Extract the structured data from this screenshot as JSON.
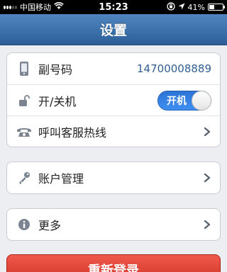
{
  "status_bar": {
    "carrier": "中国移动",
    "time": "15:23",
    "battery_text": "41%",
    "battery_level": 0.41
  },
  "nav": {
    "title": "设置"
  },
  "groups": [
    {
      "rows": [
        {
          "label": "副号码",
          "value": "14700008889",
          "icon": "phone-icon"
        },
        {
          "label": "开/关机",
          "toggle_label": "开机",
          "toggle_on": true,
          "icon": "unlock-icon"
        },
        {
          "label": "呼叫客服热线",
          "icon": "telephone-icon"
        }
      ]
    },
    {
      "rows": [
        {
          "label": "账户管理",
          "icon": "key-icon"
        }
      ]
    },
    {
      "rows": [
        {
          "label": "更多",
          "icon": "info-icon"
        }
      ]
    }
  ],
  "logout": {
    "label": "重新登录"
  },
  "colors": {
    "nav_bar": "#3a6fab",
    "toggle_on": "#3384e6",
    "logout_button": "#e0463a",
    "value_text": "#2f5d91"
  }
}
